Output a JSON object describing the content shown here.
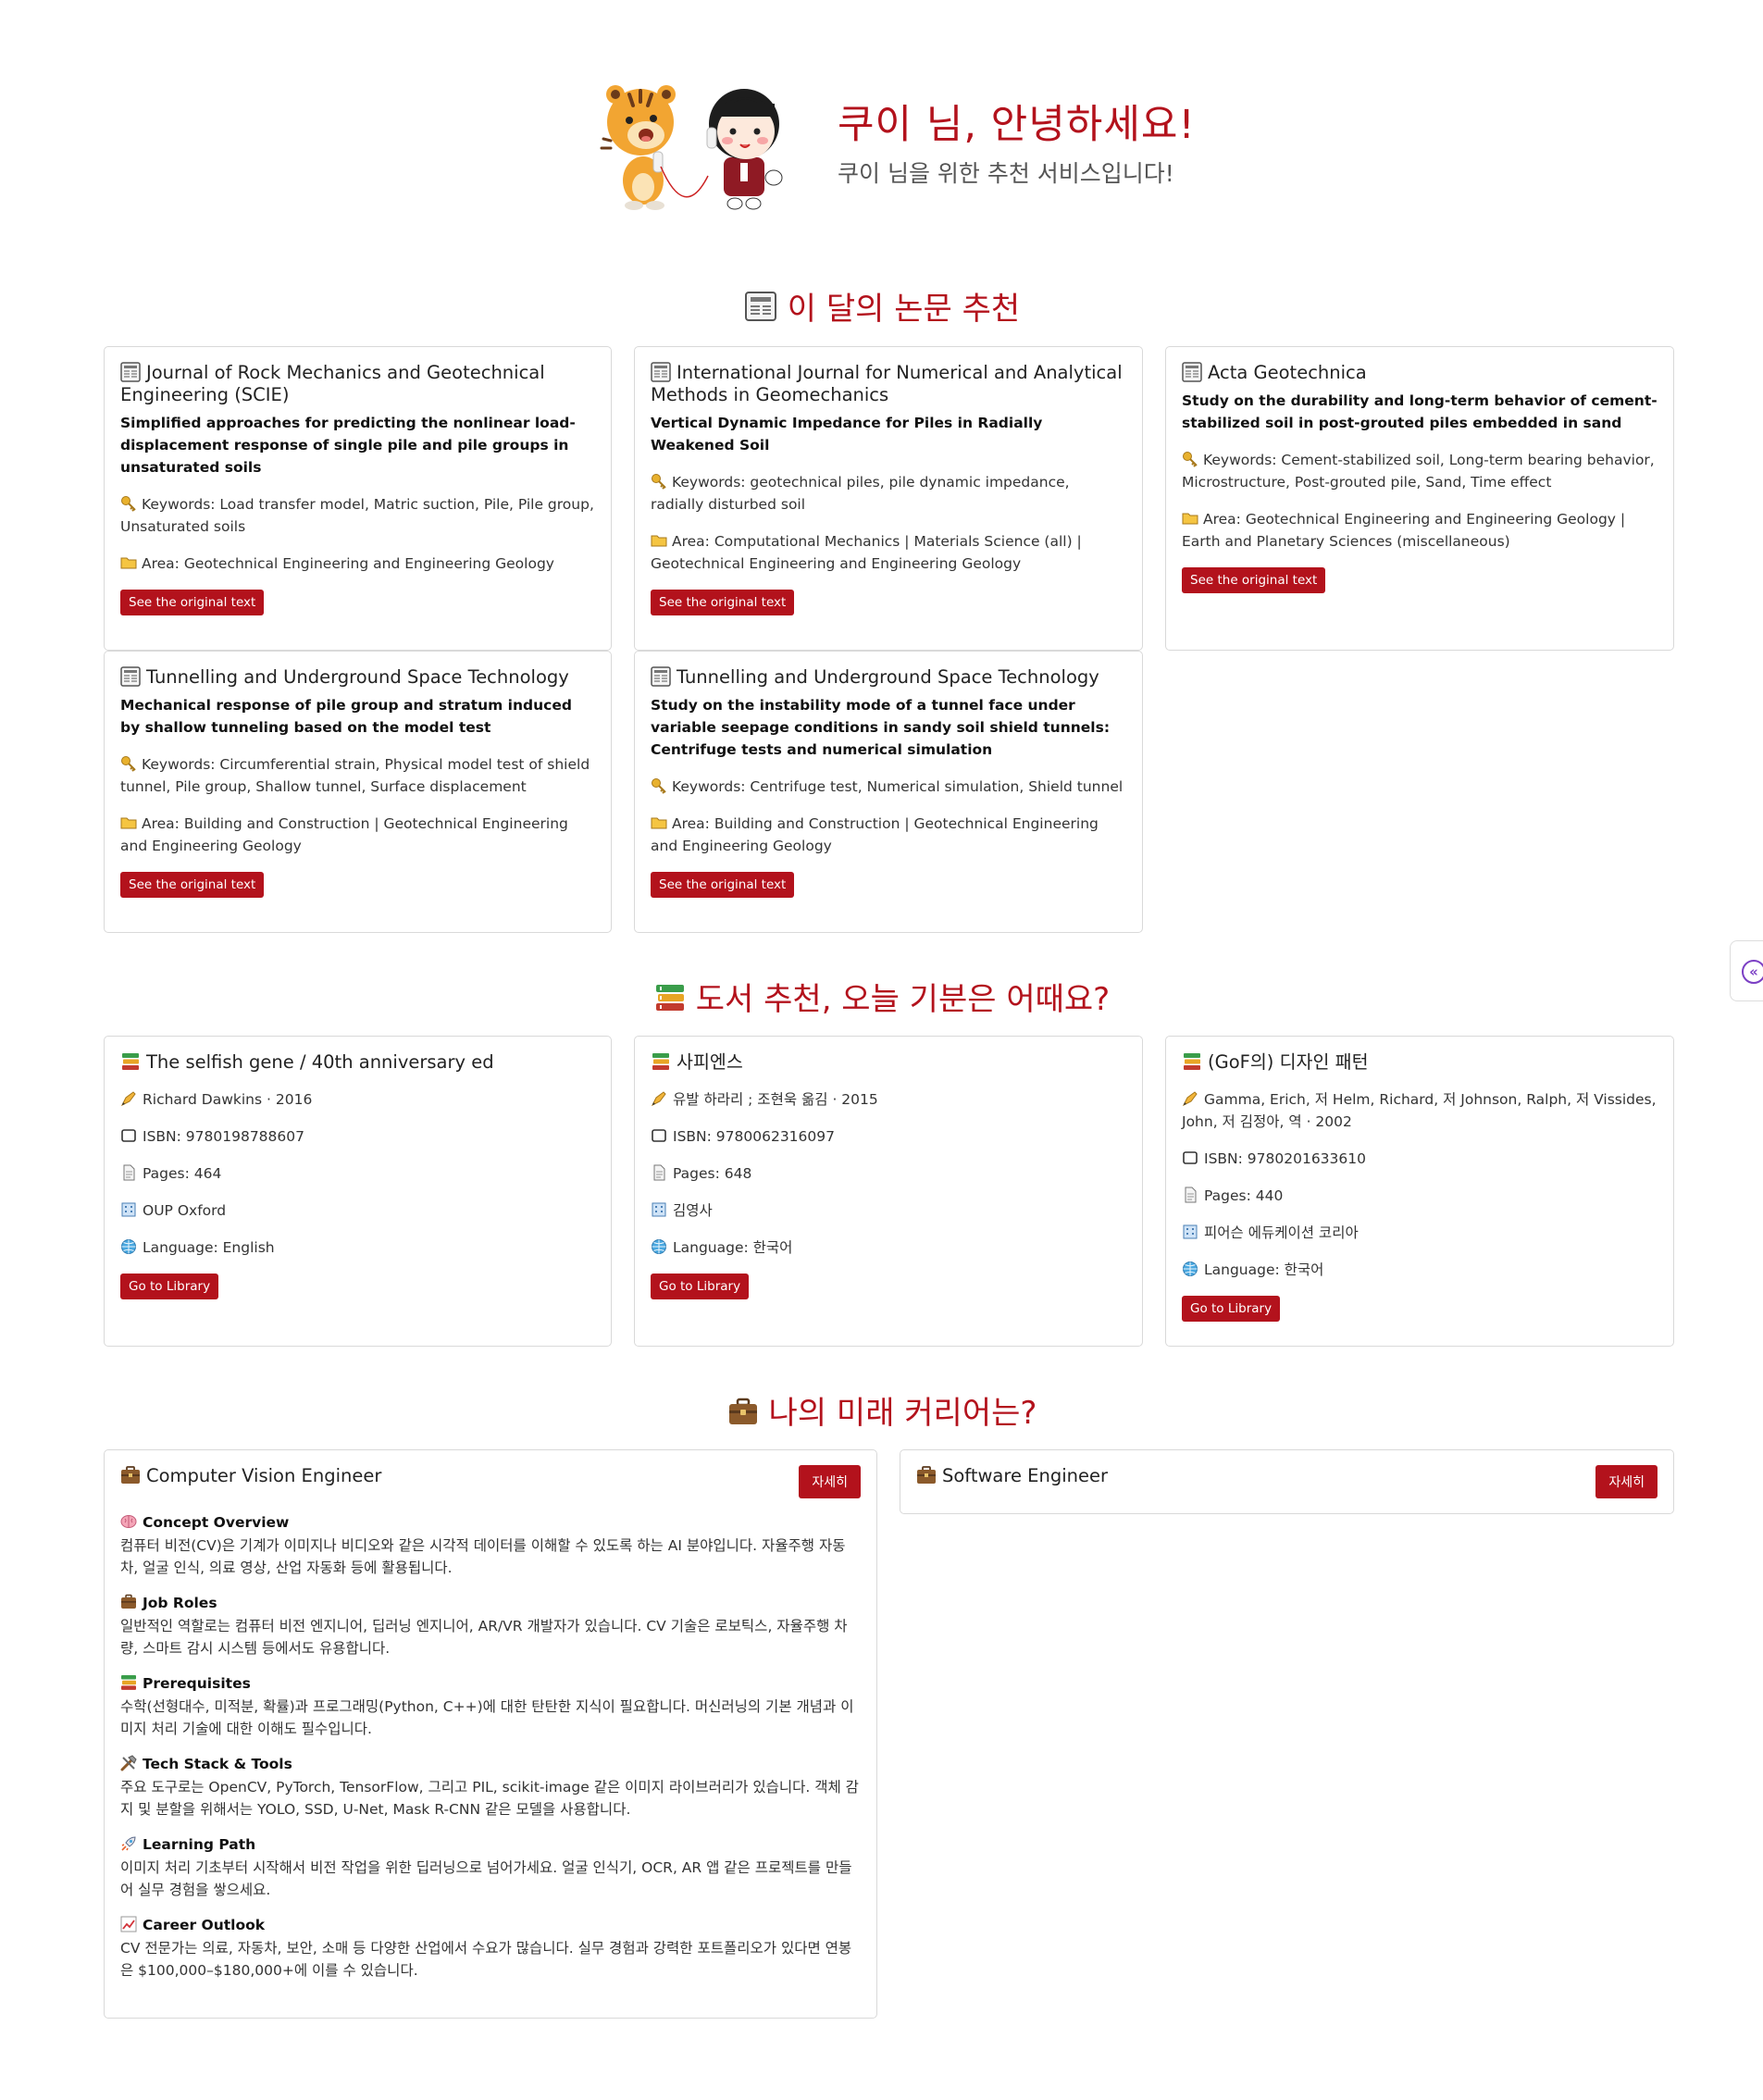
{
  "hero": {
    "title": "쿠이 님, 안녕하세요!",
    "subtitle": "쿠이 님을 위한 추천 서비스입니다!"
  },
  "papers": {
    "section_title": "이 달의 논문 추천",
    "items": [
      {
        "journal": "Journal of Rock Mechanics and Geotechnical Engineering (SCIE)",
        "title": "Simplified approaches for predicting the nonlinear load-displacement response of single pile and pile groups in unsaturated soils",
        "keywords": "Keywords: Load transfer model, Matric suction, Pile, Pile group, Unsaturated soils",
        "area": "Area: Geotechnical Engineering and Engineering Geology",
        "button": "See the original text"
      },
      {
        "journal": "International Journal for Numerical and Analytical Methods in Geomechanics",
        "title": "Vertical Dynamic Impedance for Piles in Radially Weakened Soil",
        "keywords": "Keywords: geotechnical piles, pile dynamic impedance, radially disturbed soil",
        "area": "Area: Computational Mechanics | Materials Science (all) | Geotechnical Engineering and Engineering Geology",
        "button": "See the original text"
      },
      {
        "journal": "Acta Geotechnica",
        "title": "Study on the durability and long-term behavior of cement-stabilized soil in post-grouted piles embedded in sand",
        "keywords": "Keywords: Cement-stabilized soil, Long-term bearing behavior, Microstructure, Post-grouted pile, Sand, Time effect",
        "area": "Area: Geotechnical Engineering and Engineering Geology | Earth and Planetary Sciences (miscellaneous)",
        "button": "See the original text"
      },
      {
        "journal": "Tunnelling and Underground Space Technology",
        "title": "Mechanical response of pile group and stratum induced by shallow tunneling based on the model test",
        "keywords": "Keywords: Circumferential strain, Physical model test of shield tunnel, Pile group, Shallow tunnel, Surface displacement",
        "area": "Area: Building and Construction | Geotechnical Engineering and Engineering Geology",
        "button": "See the original text"
      },
      {
        "journal": "Tunnelling and Underground Space Technology",
        "title": "Study on the instability mode of a tunnel face under variable seepage conditions in sandy soil shield tunnels: Centrifuge tests and numerical simulation",
        "keywords": "Keywords: Centrifuge test, Numerical simulation, Shield tunnel",
        "area": "Area: Building and Construction | Geotechnical Engineering and Engineering Geology",
        "button": "See the original text"
      }
    ]
  },
  "books": {
    "section_title": "도서 추천, 오늘 기분은 어때요?",
    "items": [
      {
        "title": "The selfish gene / 40th anniversary ed",
        "author": "Richard Dawkins · 2016",
        "isbn": "ISBN: 9780198788607",
        "pages": "Pages: 464",
        "publisher": "OUP Oxford",
        "language": "Language: English",
        "button": "Go to Library"
      },
      {
        "title": "사피엔스",
        "author": "유발 하라리 ; 조현욱 옮김 · 2015",
        "isbn": "ISBN: 9780062316097",
        "pages": "Pages: 648",
        "publisher": "김영사",
        "language": "Language: 한국어",
        "button": "Go to Library"
      },
      {
        "title": "(GoF의) 디자인 패턴",
        "author": "Gamma, Erich, 저 Helm, Richard, 저 Johnson, Ralph, 저 Vissides, John, 저 김정아, 역 · 2002",
        "isbn": "ISBN: 9780201633610",
        "pages": "Pages: 440",
        "publisher": "피어슨 에듀케이션 코리아",
        "language": "Language: 한국어",
        "button": "Go to Library"
      }
    ]
  },
  "careers": {
    "section_title": "나의 미래 커리어는?",
    "items": [
      {
        "title": "Computer Vision Engineer",
        "button": "자세히",
        "sections": [
          {
            "heading": "Concept Overview",
            "icon": "brain-icon",
            "body": "컴퓨터 비전(CV)은 기계가 이미지나 비디오와 같은 시각적 데이터를 이해할 수 있도록 하는 AI 분야입니다. 자율주행 자동차, 얼굴 인식, 의료 영상, 산업 자동화 등에 활용됩니다."
          },
          {
            "heading": "Job Roles",
            "icon": "briefcase-icon",
            "body": "일반적인 역할로는 컴퓨터 비전 엔지니어, 딥러닝 엔지니어, AR/VR 개발자가 있습니다. CV 기술은 로보틱스, 자율주행 차량, 스마트 감시 시스템 등에서도 유용합니다."
          },
          {
            "heading": "Prerequisites",
            "icon": "books-icon",
            "body": "수학(선형대수, 미적분, 확률)과 프로그래밍(Python, C++)에 대한 탄탄한 지식이 필요합니다. 머신러닝의 기본 개념과 이미지 처리 기술에 대한 이해도 필수입니다."
          },
          {
            "heading": "Tech Stack & Tools",
            "icon": "tools-icon",
            "body": "주요 도구로는 OpenCV, PyTorch, TensorFlow, 그리고 PIL, scikit-image 같은 이미지 라이브러리가 있습니다. 객체 감지 및 분할을 위해서는 YOLO, SSD, U-Net, Mask R-CNN 같은 모델을 사용합니다."
          },
          {
            "heading": "Learning Path",
            "icon": "rocket-icon",
            "body": "이미지 처리 기초부터 시작해서 비전 작업을 위한 딥러닝으로 넘어가세요. 얼굴 인식기, OCR, AR 앱 같은 프로젝트를 만들어 실무 경험을 쌓으세요."
          },
          {
            "heading": "Career Outlook",
            "icon": "chart-icon",
            "body": "CV 전문가는 의료, 자동차, 보안, 소매 등 다양한 산업에서 수요가 많습니다. 실무 경험과 강력한 포트폴리오가 있다면 연봉은 $100,000–$180,000+에 이를 수 있습니다."
          }
        ]
      },
      {
        "title": "Software Engineer",
        "button": "자세히"
      }
    ]
  },
  "side_tab": {
    "icon": "double-chevron-left-icon",
    "glyph": "«"
  }
}
